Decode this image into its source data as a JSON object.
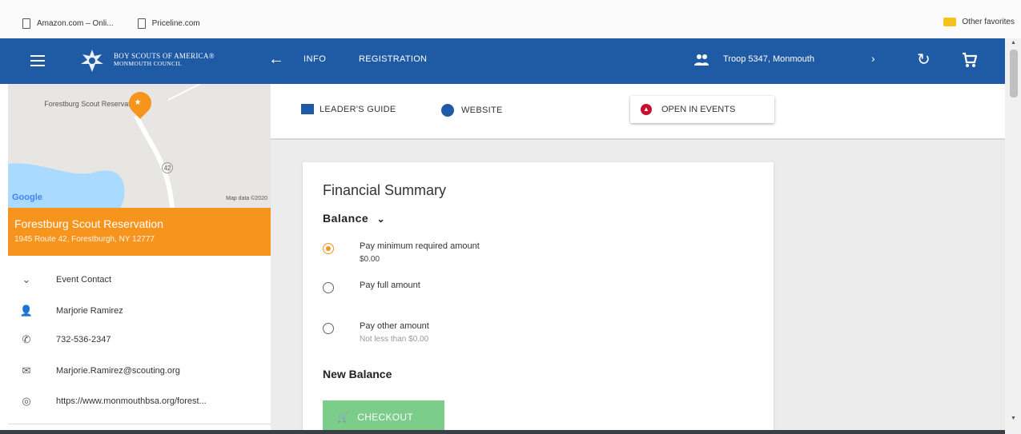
{
  "bookmarks": [
    {
      "label": "Amazon.com – Onli..."
    },
    {
      "label": "Priceline.com"
    }
  ],
  "other_favorites": "Other favorites",
  "appbar": {
    "brand_line1": "BOY SCOUTS OF AMERICA®",
    "brand_line2": "MONMOUTH COUNCIL",
    "back_icon": "arrow-left-icon",
    "tab_info": "INFO",
    "tab_registration": "REGISTRATION",
    "troop": "Troop 5347, Monmouth",
    "accent": "#f7941d",
    "color": "#1f5aa5"
  },
  "map": {
    "place_label": "Forestburg Scout Reservation",
    "route_marker": "42",
    "google": "Google",
    "map_data": "Map data ©2020"
  },
  "location": {
    "name": "Forestburg Scout Reservation",
    "address": "1945 Route 42, Forestburgh, NY 12777"
  },
  "contact": {
    "header": "Event Contact",
    "name": "Marjorie Ramirez",
    "phone": "732-536-2347",
    "email": "Marjorie.Ramirez@scouting.org",
    "website": "https://www.monmouthbsa.org/forest..."
  },
  "toolbar": {
    "leaders_guide": "LEADER'S GUIDE",
    "website": "WEBSITE",
    "open_in_events": "OPEN IN EVENTS"
  },
  "summary": {
    "title": "Financial Summary",
    "balance": "Balance",
    "options": [
      {
        "label": "Pay minimum required amount",
        "sub": "$0.00",
        "selected": true
      },
      {
        "label": "Pay full amount",
        "sub": "",
        "selected": false
      },
      {
        "label": "Pay other amount",
        "sub": "Not less than $0.00",
        "selected": false
      }
    ],
    "new_balance": "New Balance",
    "checkout": "CHECKOUT"
  }
}
